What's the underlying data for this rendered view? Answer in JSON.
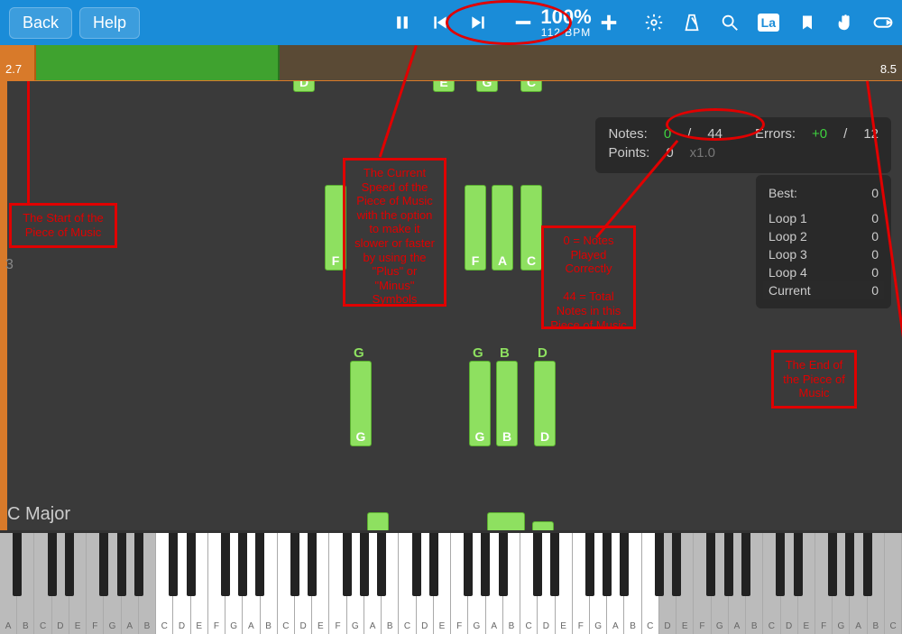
{
  "topbar": {
    "back": "Back",
    "help": "Help",
    "tempo_percent": "100%",
    "tempo_bpm": "112 BPM",
    "la": "La"
  },
  "progress": {
    "start_marker": "2.7",
    "end_marker": "8.5"
  },
  "roll": {
    "note_tops": [
      "D",
      "E",
      "G",
      "C"
    ],
    "row_label": "3",
    "notes_mid": [
      "F",
      "F",
      "A",
      "C"
    ],
    "notes_low": [
      "G",
      "G",
      "B",
      "D"
    ],
    "small_tops": [
      "G",
      "G",
      "B",
      "D"
    ],
    "key_name": "C Major"
  },
  "stats": {
    "notes_label": "Notes:",
    "notes_played": "0",
    "notes_sep": "/",
    "notes_total": "44",
    "errors_label": "Errors:",
    "errors_val": "+0",
    "errors_sep": "/",
    "errors_total": "12",
    "points_label": "Points:",
    "points_val": "0",
    "points_mult": "x1.0"
  },
  "loops": {
    "best_label": "Best:",
    "best_val": "0",
    "rows": [
      {
        "label": "Loop 1",
        "val": "0"
      },
      {
        "label": "Loop 2",
        "val": "0"
      },
      {
        "label": "Loop 3",
        "val": "0"
      },
      {
        "label": "Loop 4",
        "val": "0"
      },
      {
        "label": "Current",
        "val": "0"
      }
    ]
  },
  "annotations": {
    "start": "The Start of the Piece of Music",
    "speed": "The Current Speed of the Piece of Music with the option to make it slower or faster by using the \"Plus\" or \"Minus\" Symbols",
    "notes": "0 = Notes Played Correctly\n\n44 = Total Notes in this Piece of Music",
    "end": "The End of the Piece of Music"
  },
  "piano_letters": [
    "C",
    "D",
    "E",
    "F",
    "G",
    "A",
    "B"
  ]
}
